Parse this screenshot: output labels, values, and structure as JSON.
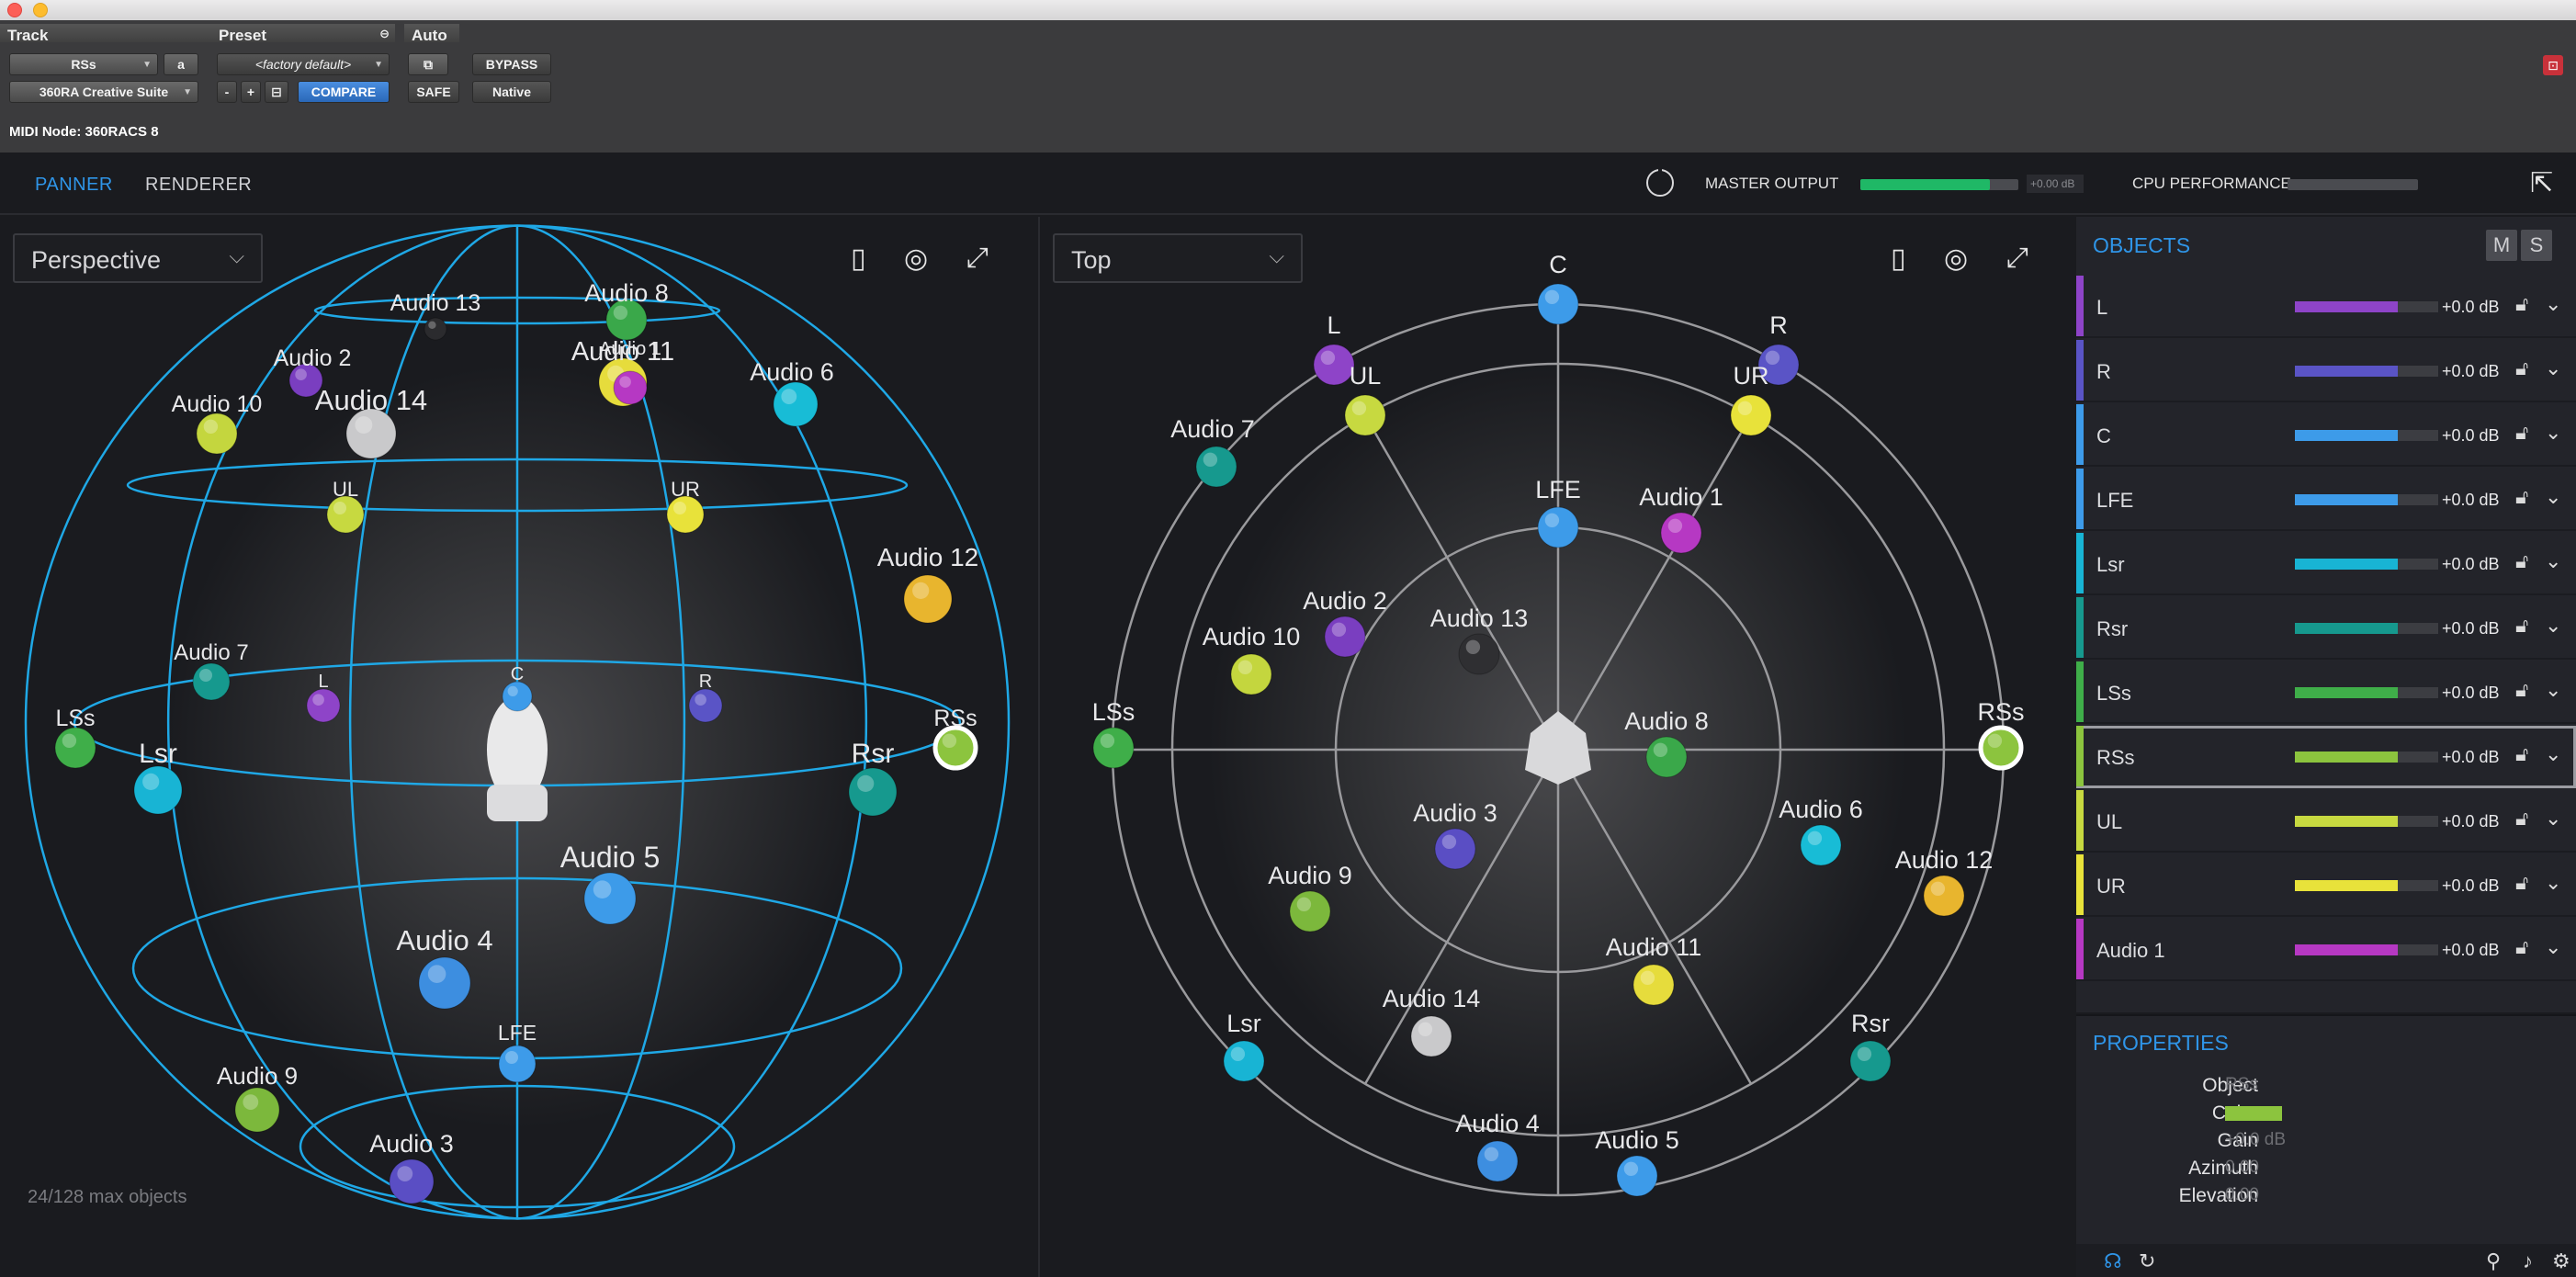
{
  "host": {
    "track_header": "Track",
    "preset_header": "Preset",
    "auto_header": "Auto",
    "track_name": "RSs",
    "track_channel": "a",
    "plugin_name": "360RA Creative Suite",
    "preset_value": "<factory default>",
    "preset_minus": "-",
    "preset_plus": "+",
    "compare": "COMPARE",
    "bypass": "BYPASS",
    "safe": "SAFE",
    "native": "Native",
    "midi_node": "MIDI Node: 360RACS 8"
  },
  "nav": {
    "panner": "PANNER",
    "renderer": "RENDERER",
    "master_output": "MASTER OUTPUT",
    "master_db": "+0.00 dB",
    "master_level": 0.82,
    "cpu_performance": "CPU PERFORMANCE",
    "cpu_level": 0.0
  },
  "left_view": {
    "mode": "Perspective"
  },
  "right_view": {
    "mode": "Top"
  },
  "status": {
    "max_objects": "24/128 max objects"
  },
  "objects_panel": {
    "title": "OBJECTS",
    "mute": "M",
    "solo": "S",
    "rows": [
      {
        "name": "L",
        "color": "#8e44c8",
        "gain": "+0.0 dB",
        "level": 0.72
      },
      {
        "name": "R",
        "color": "#5a54c6",
        "gain": "+0.0 dB",
        "level": 0.72
      },
      {
        "name": "C",
        "color": "#3d9be9",
        "gain": "+0.0 dB",
        "level": 0.72
      },
      {
        "name": "LFE",
        "color": "#3d9be9",
        "gain": "+0.0 dB",
        "level": 0.72
      },
      {
        "name": "Lsr",
        "color": "#18b4d4",
        "gain": "+0.0 dB",
        "level": 0.72
      },
      {
        "name": "Rsr",
        "color": "#16998e",
        "gain": "+0.0 dB",
        "level": 0.72
      },
      {
        "name": "LSs",
        "color": "#3fae49",
        "gain": "+0.0 dB",
        "level": 0.72
      },
      {
        "name": "RSs",
        "color": "#8cc43e",
        "gain": "+0.0 dB",
        "level": 0.72
      },
      {
        "name": "UL",
        "color": "#c7d940",
        "gain": "+0.0 dB",
        "level": 0.72
      },
      {
        "name": "UR",
        "color": "#e8e23a",
        "gain": "+0.0 dB",
        "level": 0.72
      },
      {
        "name": "Audio 1",
        "color": "#b638c3",
        "gain": "+0.0 dB",
        "level": 0.72
      }
    ]
  },
  "properties": {
    "title": "PROPERTIES",
    "object_label": "Object",
    "object_value": "RSs",
    "color_label": "Color",
    "color_value": "#8cc43e",
    "gain_label": "Gain",
    "gain_value": "+0.0 dB",
    "azimuth_label": "Azimuth",
    "azimuth_value": "0.00",
    "elevation_label": "Elevation",
    "elevation_value": "0.00"
  },
  "perspective_objects": [
    {
      "label": "Audio 13",
      "color": "#2b2b2e",
      "fs": 25
    },
    {
      "label": "Audio 8",
      "color": "#3aa84a",
      "fs": 27
    },
    {
      "label": "Audio 2",
      "color": "#7a3ec0",
      "fs": 25
    },
    {
      "label": "Audio 11",
      "color": "#e6dc3c",
      "fs": 29
    },
    {
      "label": "Audio 1",
      "color": "#b638c3",
      "fs": 20
    },
    {
      "label": "Audio 6",
      "color": "#18bcd6",
      "fs": 27
    },
    {
      "label": "Audio 10",
      "color": "#c4d63e",
      "fs": 25
    },
    {
      "label": "Audio 14",
      "color": "#c9c9cb",
      "fs": 31
    },
    {
      "label": "UL",
      "color": "#c7d940",
      "fs": 22
    },
    {
      "label": "UR",
      "color": "#e8e23a",
      "fs": 22
    },
    {
      "label": "Audio 12",
      "color": "#e8b52e",
      "fs": 28
    },
    {
      "label": "Audio 7",
      "color": "#16998e",
      "fs": 24
    },
    {
      "label": "L",
      "color": "#8e44c8",
      "fs": 20
    },
    {
      "label": "C",
      "color": "#3d9be9",
      "fs": 20
    },
    {
      "label": "R",
      "color": "#5a54c6",
      "fs": 20
    },
    {
      "label": "LSs",
      "color": "#3fae49",
      "fs": 25
    },
    {
      "label": "RSs",
      "color": "#8cc43e",
      "fs": 25
    },
    {
      "label": "Lsr",
      "color": "#18b4d4",
      "fs": 30
    },
    {
      "label": "Rsr",
      "color": "#16998e",
      "fs": 30
    },
    {
      "label": "Audio 5",
      "color": "#3d9be9",
      "fs": 32
    },
    {
      "label": "Audio 4",
      "color": "#3d8ee0",
      "fs": 31
    },
    {
      "label": "LFE",
      "color": "#3d9be9",
      "fs": 23
    },
    {
      "label": "Audio 9",
      "color": "#7cb83c",
      "fs": 26
    },
    {
      "label": "Audio 3",
      "color": "#5a4ec4",
      "fs": 27
    }
  ],
  "top_objects": [
    {
      "label": "C",
      "color": "#3d9be9"
    },
    {
      "label": "L",
      "color": "#8e44c8"
    },
    {
      "label": "R",
      "color": "#5a54c6"
    },
    {
      "label": "UL",
      "color": "#c7d940"
    },
    {
      "label": "UR",
      "color": "#e8e23a"
    },
    {
      "label": "Audio 7",
      "color": "#16998e"
    },
    {
      "label": "LFE",
      "color": "#3d9be9"
    },
    {
      "label": "Audio 1",
      "color": "#b638c3"
    },
    {
      "label": "Audio 2",
      "color": "#7a3ec0"
    },
    {
      "label": "Audio 13",
      "color": "#2f2f32"
    },
    {
      "label": "Audio 10",
      "color": "#c4d63e"
    },
    {
      "label": "LSs",
      "color": "#3fae49"
    },
    {
      "label": "Audio 8",
      "color": "#3aa84a"
    },
    {
      "label": "RSs",
      "color": "#8cc43e"
    },
    {
      "label": "Audio 3",
      "color": "#5a4ec4"
    },
    {
      "label": "Audio 6",
      "color": "#18bcd6"
    },
    {
      "label": "Audio 12",
      "color": "#e8b52e"
    },
    {
      "label": "Audio 9",
      "color": "#7cb83c"
    },
    {
      "label": "Audio 11",
      "color": "#e6dc3c"
    },
    {
      "label": "Audio 14",
      "color": "#c9c9cb"
    },
    {
      "label": "Lsr",
      "color": "#18b4d4"
    },
    {
      "label": "Rsr",
      "color": "#16998e"
    },
    {
      "label": "Audio 4",
      "color": "#3d8ee0"
    },
    {
      "label": "Audio 5",
      "color": "#3d9be9"
    }
  ]
}
